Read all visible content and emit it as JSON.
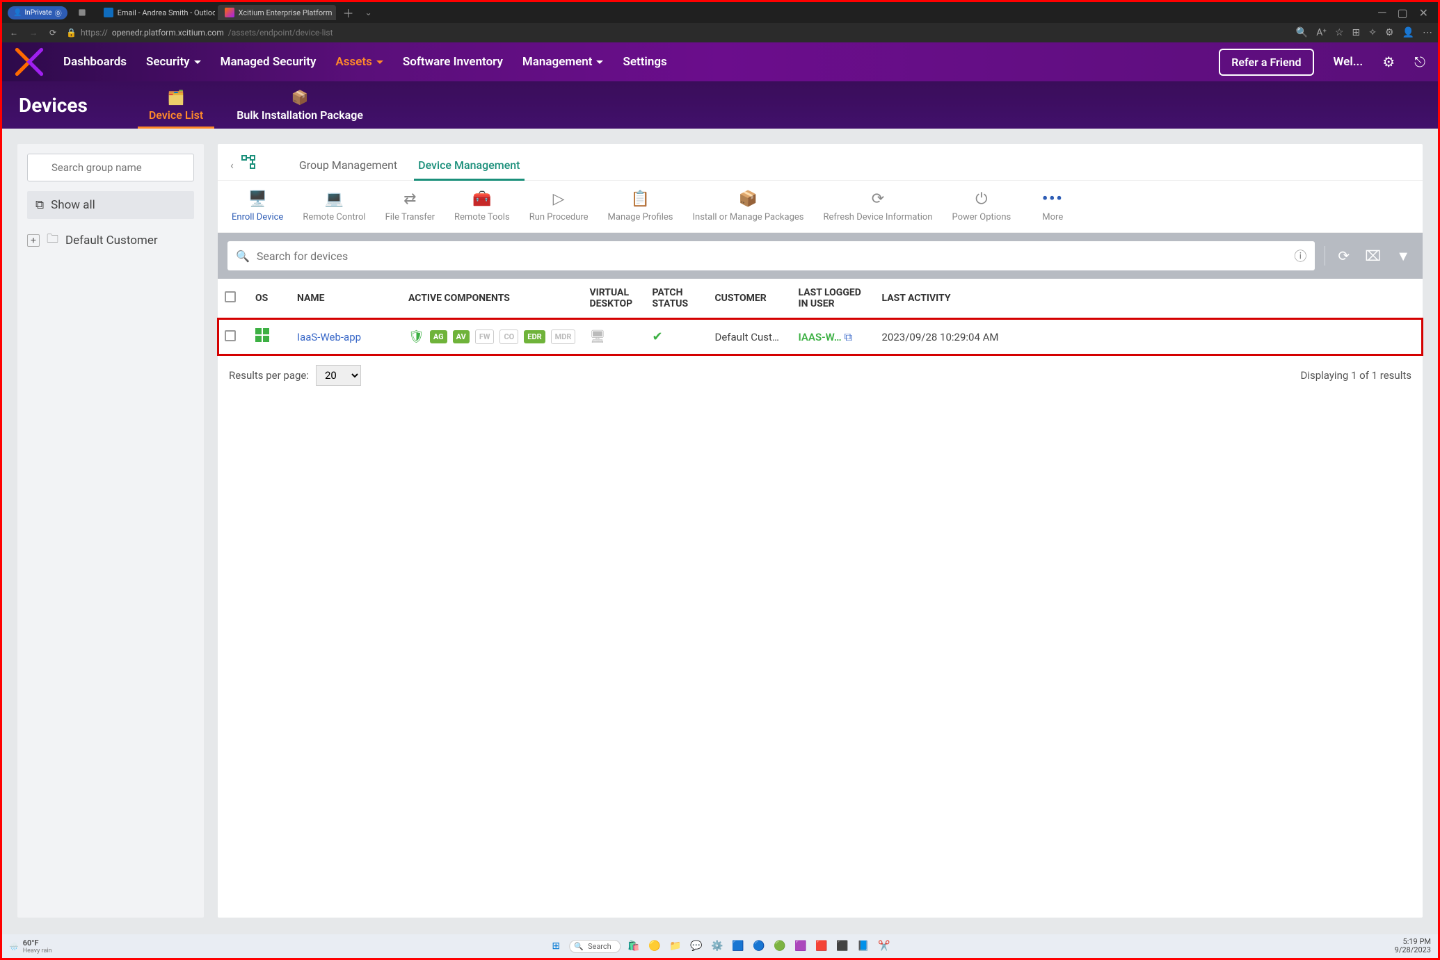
{
  "browser": {
    "inprivate_label": "InPrivate",
    "tabs": [
      {
        "label": "Email - Andrea Smith - Outlook"
      },
      {
        "label": "Xcitium Enterprise Platform"
      }
    ],
    "url_host": "openedr.platform.xcitium.com",
    "url_path": "/assets/endpoint/device-list"
  },
  "topnav": {
    "items": [
      "Dashboards",
      "Security",
      "Managed Security",
      "Assets",
      "Software Inventory",
      "Management",
      "Settings"
    ],
    "active": "Assets",
    "refer_label": "Refer a Friend",
    "welcome_label": "Wel..."
  },
  "subnav": {
    "page_title": "Devices",
    "tabs": [
      "Device List",
      "Bulk Installation Package"
    ],
    "active": "Device List"
  },
  "sidebar": {
    "search_placeholder": "Search group name",
    "show_all_label": "Show all",
    "tree": [
      {
        "label": "Default Customer"
      }
    ]
  },
  "main": {
    "tabs": [
      "Group Management",
      "Device Management"
    ],
    "active_tab": "Device Management",
    "tools": [
      "Enroll Device",
      "Remote Control",
      "File Transfer",
      "Remote Tools",
      "Run Procedure",
      "Manage Profiles",
      "Install or Manage Packages",
      "Refresh Device Information",
      "Power Options",
      "More"
    ],
    "active_tool": "Enroll Device",
    "device_search_placeholder": "Search for devices",
    "columns": [
      "OS",
      "NAME",
      "ACTIVE COMPONENTS",
      "VIRTUAL DESKTOP",
      "PATCH STATUS",
      "CUSTOMER",
      "LAST LOGGED IN USER",
      "LAST ACTIVITY"
    ],
    "rows": [
      {
        "os": "windows",
        "name": "IaaS-Web-app",
        "components": [
          {
            "code": "AG",
            "on": true
          },
          {
            "code": "AV",
            "on": true
          },
          {
            "code": "FW",
            "on": false
          },
          {
            "code": "CO",
            "on": false
          },
          {
            "code": "EDR",
            "on": true
          },
          {
            "code": "MDR",
            "on": false
          }
        ],
        "virtual_desktop": "off",
        "patch_status": "ok",
        "customer": "Default Cust…",
        "last_user": "IAAS-W…",
        "last_activity": "2023/09/28 10:29:04 AM"
      }
    ],
    "pager": {
      "label": "Results per page:",
      "value": "20",
      "display": "Displaying 1 of 1 results"
    }
  },
  "taskbar": {
    "weather_temp": "60°F",
    "weather_desc": "Heavy rain",
    "search_label": "Search",
    "time": "5:19 PM",
    "date": "9/28/2023"
  }
}
